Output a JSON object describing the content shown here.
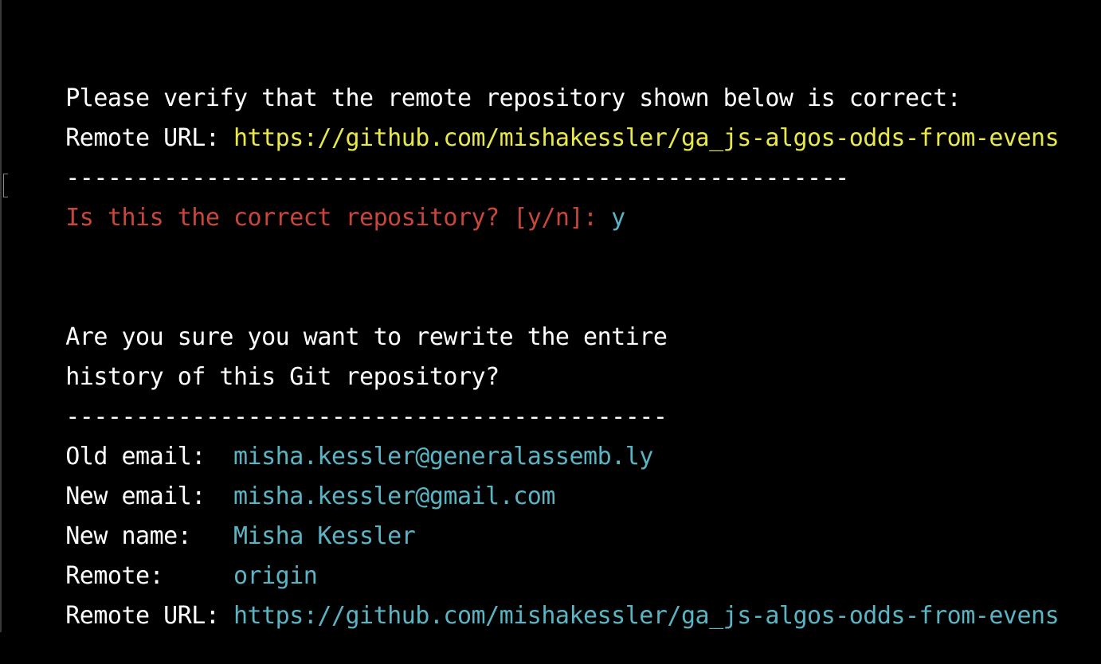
{
  "verify_block": {
    "prompt": "Please verify that the remote repository shown below is correct:",
    "remote_url_label": "Remote URL: ",
    "remote_url_value": "https://github.com/mishakessler/ga_js-algos-odds-from-evens",
    "divider": "--------------------------------------------------------",
    "question": "Is this the correct repository? [y/n]: ",
    "answer": "y"
  },
  "rewrite_block": {
    "question_line1": "Are you sure you want to rewrite the entire",
    "question_line2": "history of this Git repository?",
    "divider": "-------------------------------------------",
    "old_email_label": "Old email:  ",
    "old_email_value": "misha.kessler@generalassemb.ly",
    "new_email_label": "New email:  ",
    "new_email_value": "misha.kessler@gmail.com",
    "new_name_label": "New name:   ",
    "new_name_value": "Misha Kessler",
    "remote_label": "Remote:     ",
    "remote_value": "origin",
    "remote_url_label": "Remote URL: ",
    "remote_url_value": "https://github.com/mishakessler/ga_js-algos-odds-from-evens"
  },
  "colors": {
    "background": "#000000",
    "text": "#ffffff",
    "url_yellow": "#e8e84a",
    "prompt_red": "#c8463a",
    "value_cyan": "#5ab4c4"
  }
}
